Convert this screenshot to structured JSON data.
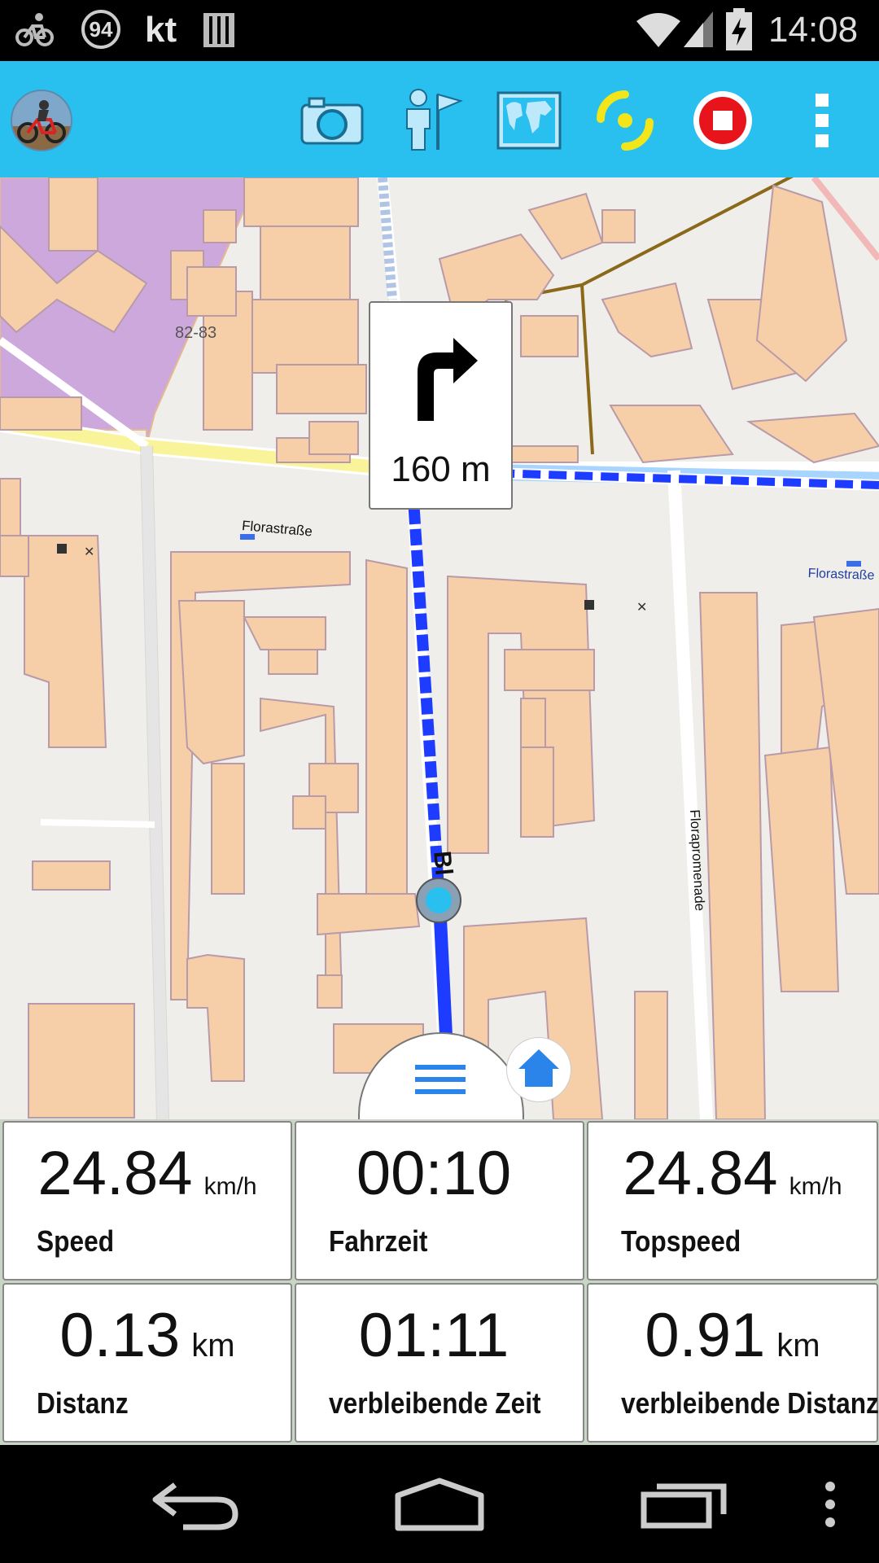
{
  "status_bar": {
    "battery_percent": "94",
    "carrier": "kt",
    "time": "14:08"
  },
  "action_bar": {
    "icons": [
      "app-avatar",
      "camera-icon",
      "waypoint-icon",
      "map-icon",
      "gps-fix-icon",
      "stop-record-icon",
      "overflow-menu-icon"
    ],
    "accent": "#29c0ef"
  },
  "map": {
    "navigation": {
      "distance": "160 m",
      "maneuver": "turn-right"
    },
    "labels": {
      "house_number": "82-83",
      "street_1": "Florastraße",
      "street_1b": "Florastraße",
      "street_2": "Florapromenade",
      "street_3": "Bl"
    }
  },
  "stats": [
    {
      "value": "24.84",
      "unit": "km/h",
      "label": "Speed"
    },
    {
      "value": "00:10",
      "unit": "",
      "label": "Fahrzeit"
    },
    {
      "value": "24.84",
      "unit": "km/h",
      "label": "Topspeed"
    },
    {
      "value": "0.13",
      "unit": "km",
      "label": "Distanz"
    },
    {
      "value": "01:11",
      "unit": "",
      "label": "verbleibende Zeit"
    },
    {
      "value": "0.91",
      "unit": "km",
      "label": "verbleibende Distanz"
    }
  ],
  "colors": {
    "route": "#1e3cff",
    "buildings": "#f6cfa9",
    "park": "#cda8dc"
  }
}
